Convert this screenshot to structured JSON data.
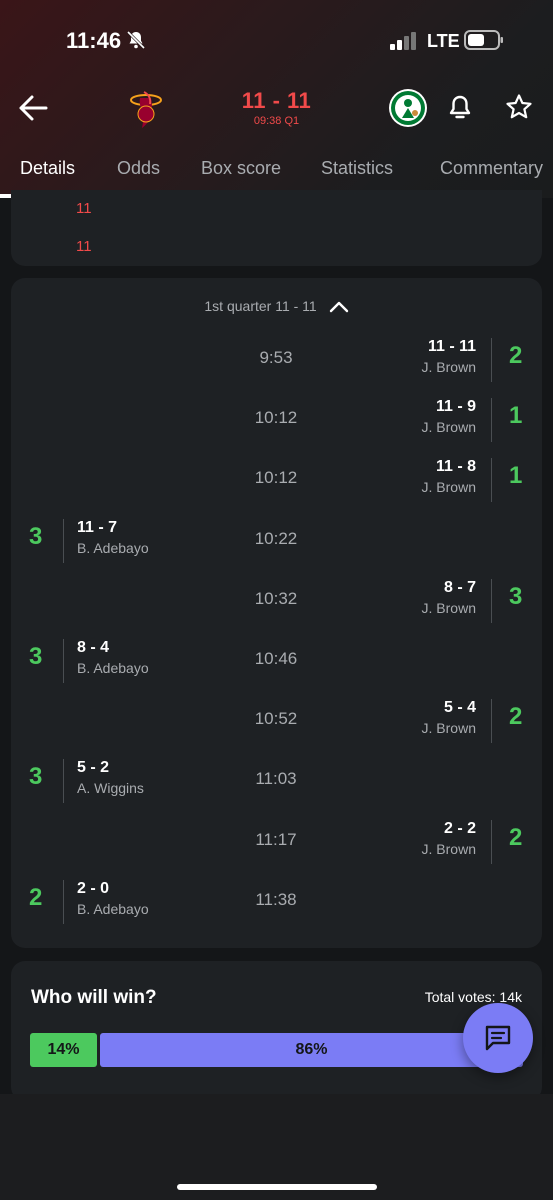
{
  "status_bar": {
    "time": "11:46",
    "network": "LTE",
    "mute_icon": "bell-slash-icon",
    "signal_icon": "signal-bars-icon",
    "battery_icon": "battery-icon"
  },
  "header": {
    "score": "11 - 11",
    "clock": "09:38 Q1",
    "home_team_logo": "heat-logo",
    "away_team_logo": "celtics-logo",
    "colors": {
      "score": "#f14a4a"
    }
  },
  "tabs": [
    {
      "label": "Details",
      "active": true
    },
    {
      "label": "Odds",
      "active": false
    },
    {
      "label": "Box score",
      "active": false
    },
    {
      "label": "Statistics",
      "active": false
    },
    {
      "label": "Commentary",
      "active": false
    }
  ],
  "previous_section": {
    "scores": [
      "11",
      "11"
    ]
  },
  "quarter": {
    "title": "1st quarter 11 - 11",
    "events": [
      {
        "side": "away",
        "time": "9:53",
        "score": "11 - 11",
        "player": "J. Brown",
        "points": "2"
      },
      {
        "side": "away",
        "time": "10:12",
        "score": "11 - 9",
        "player": "J. Brown",
        "points": "1"
      },
      {
        "side": "away",
        "time": "10:12",
        "score": "11 - 8",
        "player": "J. Brown",
        "points": "1"
      },
      {
        "side": "home",
        "time": "10:22",
        "score": "11 - 7",
        "player": "B. Adebayo",
        "points": "3"
      },
      {
        "side": "away",
        "time": "10:32",
        "score": "8 - 7",
        "player": "J. Brown",
        "points": "3"
      },
      {
        "side": "home",
        "time": "10:46",
        "score": "8 - 4",
        "player": "B. Adebayo",
        "points": "3"
      },
      {
        "side": "away",
        "time": "10:52",
        "score": "5 - 4",
        "player": "J. Brown",
        "points": "2"
      },
      {
        "side": "home",
        "time": "11:03",
        "score": "5 - 2",
        "player": "A. Wiggins",
        "points": "3"
      },
      {
        "side": "away",
        "time": "11:17",
        "score": "2 - 2",
        "player": "J. Brown",
        "points": "2"
      },
      {
        "side": "home",
        "time": "11:38",
        "score": "2 - 0",
        "player": "B. Adebayo",
        "points": "2"
      }
    ]
  },
  "vote": {
    "title": "Who will win?",
    "total": "Total votes: 14k",
    "home_pct_label": "14%",
    "away_pct_label": "86%",
    "home_pct": 14,
    "away_pct": 86,
    "colors": {
      "home": "#4cc95e",
      "away": "#7b7cf5"
    }
  },
  "fab": {
    "icon": "chat-icon"
  }
}
